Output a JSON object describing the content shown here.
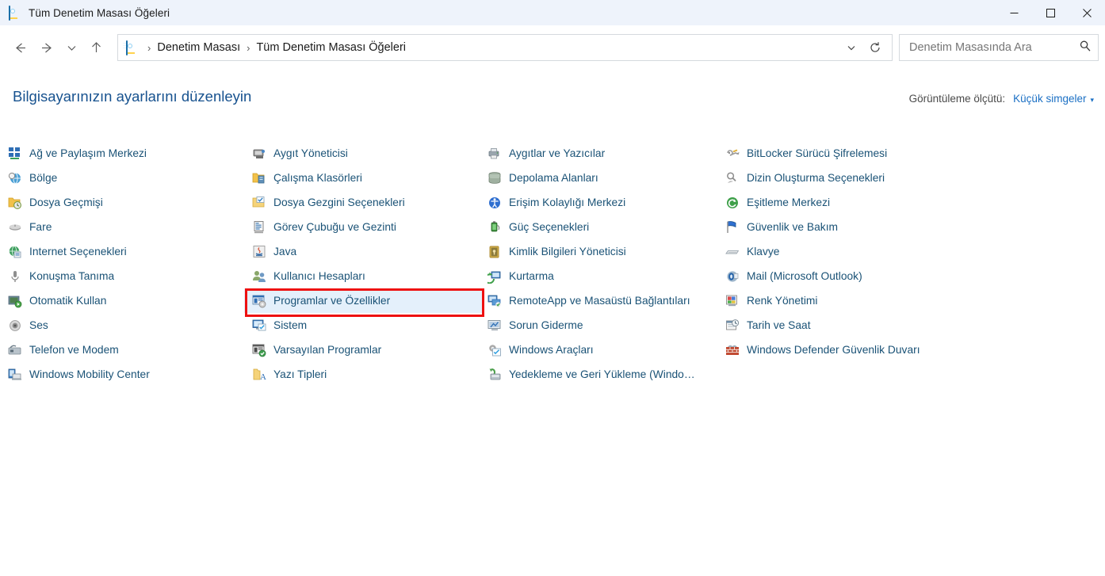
{
  "window": {
    "title": "Tüm Denetim Masası Öğeleri",
    "app_icon": "control-panel-icon",
    "minimize_label": "Simge Durumuna Küçült",
    "maximize_label": "Ekranı Kapla",
    "close_label": "Kapat"
  },
  "navigation": {
    "back_label": "Geri",
    "forward_label": "İleri",
    "recent_label": "Son Konumlar",
    "up_label": "Yukarı"
  },
  "breadcrumb": {
    "icon": "control-panel-icon",
    "items": [
      "Denetim Masası",
      "Tüm Denetim Masası Öğeleri"
    ],
    "separator": "›",
    "dropdown_label": "Önceki Konumlar",
    "refresh_label": "Yenile"
  },
  "search": {
    "placeholder": "Denetim Masasında Ara",
    "value": "",
    "icon": "search-icon"
  },
  "main": {
    "heading": "Bilgisayarınızın ayarlarını düzenleyin",
    "view_by_label": "Görüntüleme ölçütü:",
    "view_by_value": "Küçük simgeler",
    "view_by_caret": "▾"
  },
  "colors": {
    "titlebar_bg": "#eef3fb",
    "heading_text": "#17528f",
    "item_text": "#1a5276",
    "link_blue": "#1a6fc4",
    "selection_fill": "#e4f0fb",
    "highlight_border": "#ee1111"
  },
  "columns": [
    {
      "items": [
        {
          "label": "Ağ ve Paylaşım Merkezi",
          "icon": "network-sharing-icon",
          "selected": false
        },
        {
          "label": "Bölge",
          "icon": "region-globe-icon",
          "selected": false
        },
        {
          "label": "Dosya Geçmişi",
          "icon": "file-history-icon",
          "selected": false
        },
        {
          "label": "Fare",
          "icon": "mouse-icon",
          "selected": false
        },
        {
          "label": "Internet Seçenekleri",
          "icon": "internet-options-icon",
          "selected": false
        },
        {
          "label": "Konuşma Tanıma",
          "icon": "microphone-icon",
          "selected": false
        },
        {
          "label": "Otomatik Kullan",
          "icon": "autoplay-icon",
          "selected": false
        },
        {
          "label": "Ses",
          "icon": "sound-speaker-icon",
          "selected": false
        },
        {
          "label": "Telefon ve Modem",
          "icon": "phone-modem-icon",
          "selected": false
        },
        {
          "label": "Windows Mobility Center",
          "icon": "mobility-center-icon",
          "selected": false
        }
      ]
    },
    {
      "items": [
        {
          "label": "Aygıt Yöneticisi",
          "icon": "device-manager-icon",
          "selected": false
        },
        {
          "label": "Çalışma Klasörleri",
          "icon": "work-folders-icon",
          "selected": false
        },
        {
          "label": "Dosya Gezgini Seçenekleri",
          "icon": "file-explorer-options-icon",
          "selected": false
        },
        {
          "label": "Görev Çubuğu ve Gezinti",
          "icon": "taskbar-navigation-icon",
          "selected": false
        },
        {
          "label": "Java",
          "icon": "java-icon",
          "selected": false
        },
        {
          "label": "Kullanıcı Hesapları",
          "icon": "user-accounts-icon",
          "selected": false
        },
        {
          "label": "Programlar ve Özellikler",
          "icon": "programs-features-icon",
          "selected": true
        },
        {
          "label": "Sistem",
          "icon": "system-icon",
          "selected": false
        },
        {
          "label": "Varsayılan Programlar",
          "icon": "default-programs-icon",
          "selected": false
        },
        {
          "label": "Yazı Tipleri",
          "icon": "fonts-icon",
          "selected": false
        }
      ]
    },
    {
      "items": [
        {
          "label": "Aygıtlar ve Yazıcılar",
          "icon": "devices-printers-icon",
          "selected": false
        },
        {
          "label": "Depolama Alanları",
          "icon": "storage-spaces-icon",
          "selected": false
        },
        {
          "label": "Erişim Kolaylığı Merkezi",
          "icon": "ease-of-access-icon",
          "selected": false
        },
        {
          "label": "Güç Seçenekleri",
          "icon": "power-options-icon",
          "selected": false
        },
        {
          "label": "Kimlik Bilgileri Yöneticisi",
          "icon": "credential-manager-icon",
          "selected": false
        },
        {
          "label": "Kurtarma",
          "icon": "recovery-icon",
          "selected": false
        },
        {
          "label": "RemoteApp ve Masaüstü Bağlantıları",
          "icon": "remoteapp-icon",
          "selected": false
        },
        {
          "label": "Sorun Giderme",
          "icon": "troubleshooting-icon",
          "selected": false
        },
        {
          "label": "Windows Araçları",
          "icon": "windows-tools-icon",
          "selected": false
        },
        {
          "label": "Yedekleme ve Geri Yükleme (Windo…",
          "icon": "backup-restore-icon",
          "selected": false
        }
      ]
    },
    {
      "items": [
        {
          "label": "BitLocker Sürücü Şifrelemesi",
          "icon": "bitlocker-icon",
          "selected": false
        },
        {
          "label": "Dizin Oluşturma Seçenekleri",
          "icon": "indexing-options-icon",
          "selected": false
        },
        {
          "label": "Eşitleme Merkezi",
          "icon": "sync-center-icon",
          "selected": false
        },
        {
          "label": "Güvenlik ve Bakım",
          "icon": "security-maintenance-icon",
          "selected": false
        },
        {
          "label": "Klavye",
          "icon": "keyboard-icon",
          "selected": false
        },
        {
          "label": "Mail (Microsoft Outlook)",
          "icon": "mail-outlook-icon",
          "selected": false
        },
        {
          "label": "Renk Yönetimi",
          "icon": "color-management-icon",
          "selected": false
        },
        {
          "label": "Tarih ve Saat",
          "icon": "date-time-icon",
          "selected": false
        },
        {
          "label": "Windows Defender Güvenlik Duvarı",
          "icon": "firewall-icon",
          "selected": false
        }
      ]
    }
  ]
}
